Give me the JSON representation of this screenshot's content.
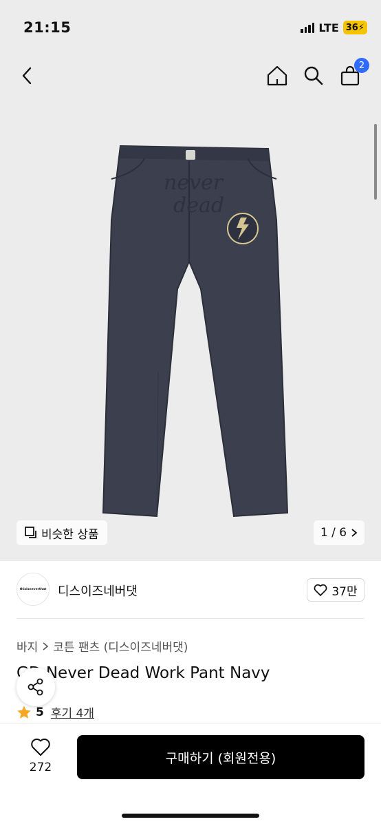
{
  "status": {
    "time": "21:15",
    "network": "LTE",
    "battery": "36"
  },
  "nav": {
    "cart_count": "2"
  },
  "gallery": {
    "similar_label": "비슷한 상품",
    "page_indicator": "1 / 6"
  },
  "brand": {
    "logo_text": "thisisneverthat",
    "name": "디스이즈네버댓",
    "likes": "37만"
  },
  "breadcrumb": {
    "category": "바지",
    "subcategory": "코튼 팬츠 (디스이즈네버댓)"
  },
  "product": {
    "title": "GD Never Dead Work Pant Navy",
    "rating": "5",
    "reviews": "후기 4개"
  },
  "bottom": {
    "wish_count": "272",
    "buy_label": "구매하기 (회원전용)"
  },
  "colors": {
    "accent": "#2f6bff",
    "battery": "#f5c400",
    "pants": "#3b3f4e"
  }
}
